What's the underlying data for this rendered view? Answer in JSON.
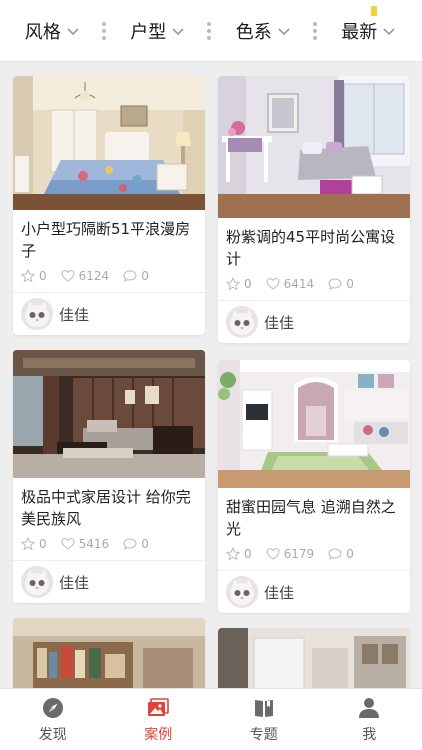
{
  "filters": [
    {
      "label": "风格"
    },
    {
      "label": "户型"
    },
    {
      "label": "色系"
    },
    {
      "label": "最新"
    }
  ],
  "cards": [
    {
      "title": "小户型巧隔断51平浪漫房子",
      "stars": "0",
      "likes": "6124",
      "comments": "0",
      "author": "佳佳"
    },
    {
      "title": "粉紫调的45平时尚公寓设计",
      "stars": "0",
      "likes": "6414",
      "comments": "0",
      "author": "佳佳"
    },
    {
      "title": "极品中式家居设计 给你完美民族风",
      "stars": "0",
      "likes": "5416",
      "comments": "0",
      "author": "佳佳"
    },
    {
      "title": "甜蜜田园气息 追溯自然之光",
      "stars": "0",
      "likes": "6179",
      "comments": "0",
      "author": "佳佳"
    }
  ],
  "tabs": [
    {
      "label": "发现",
      "icon": "compass-icon"
    },
    {
      "label": "案例",
      "icon": "gallery-icon"
    },
    {
      "label": "专题",
      "icon": "book-icon"
    },
    {
      "label": "我",
      "icon": "person-icon"
    }
  ],
  "colors": {
    "accent": "#e2413e",
    "yellow_mark": "#f3d23a"
  }
}
